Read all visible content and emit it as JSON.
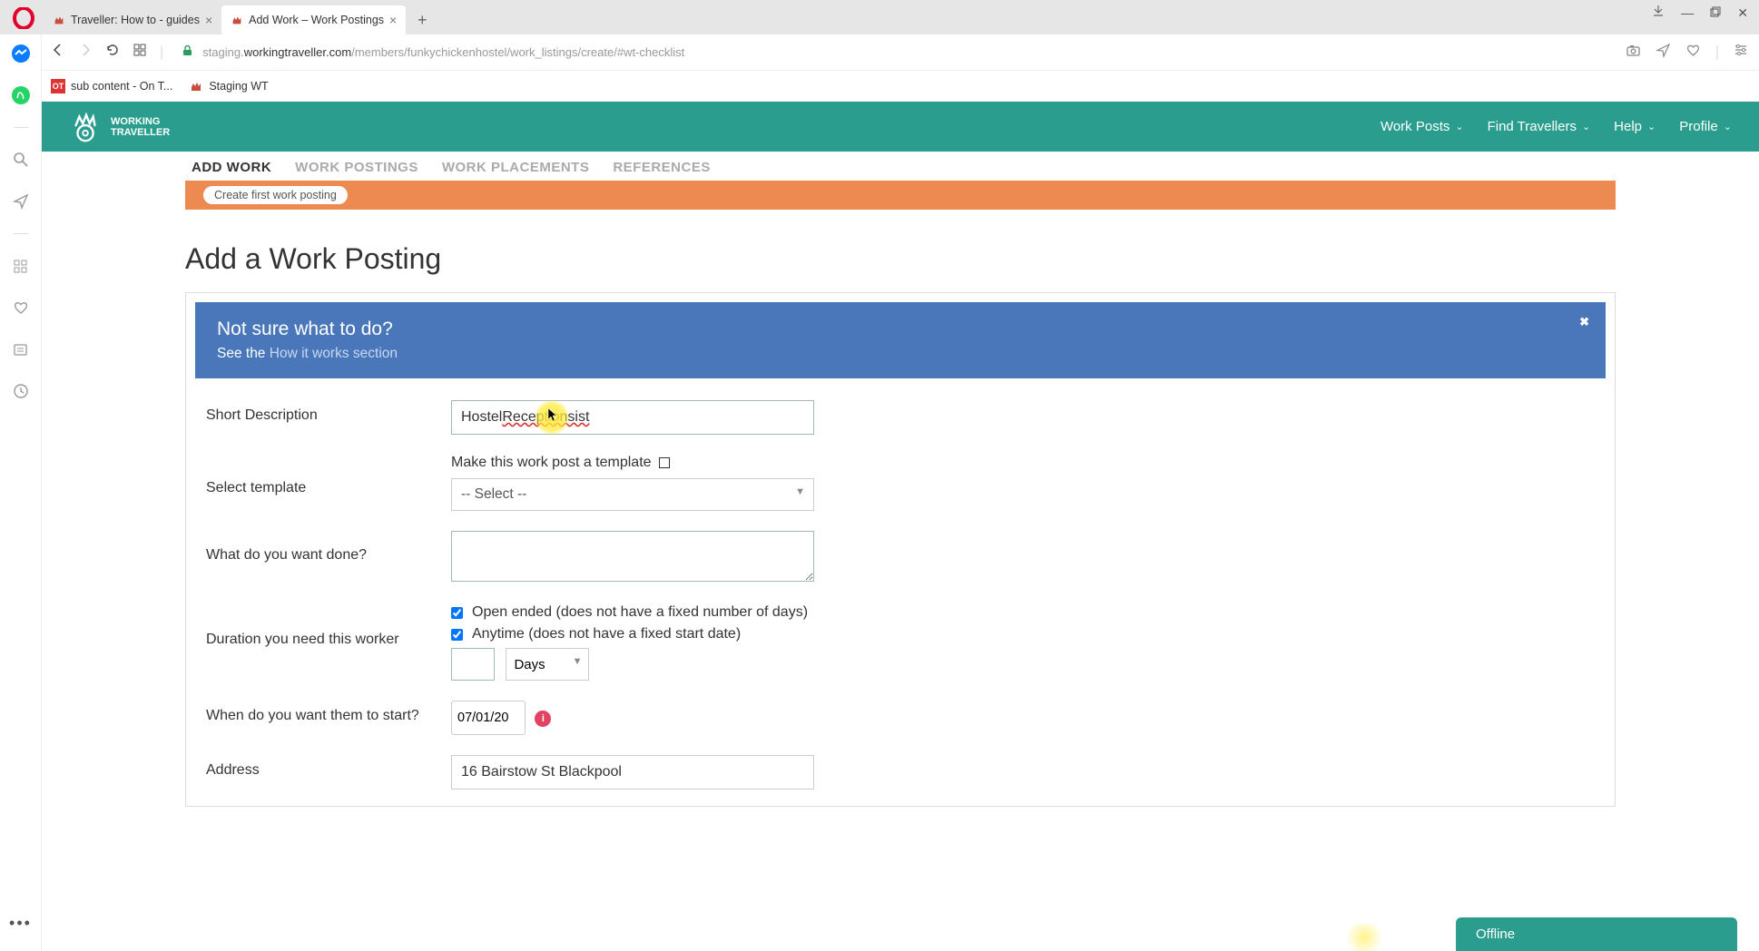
{
  "browser": {
    "tabs": [
      {
        "title": "Traveller: How to - guides",
        "active": false
      },
      {
        "title": "Add Work – Work Postings",
        "active": true
      }
    ],
    "url_prefix": "staging.",
    "url_domain": "workingtraveller.com",
    "url_path": "/members/funkychickenhostel/work_listings/create/#wt-checklist",
    "bookmarks": [
      {
        "label": "sub content - On T..."
      },
      {
        "label": "Staging WT"
      }
    ]
  },
  "nav": {
    "logo_line1": "WORKING",
    "logo_line2": "TRAVELLER",
    "items": [
      {
        "label": "Work Posts",
        "dropdown": true
      },
      {
        "label": "Find Travellers",
        "dropdown": true
      },
      {
        "label": "Help",
        "dropdown": true
      },
      {
        "label": "Profile",
        "dropdown": true
      }
    ]
  },
  "subnav": {
    "items": [
      {
        "label": "ADD WORK",
        "active": true
      },
      {
        "label": "WORK POSTINGS",
        "active": false
      },
      {
        "label": "WORK PLACEMENTS",
        "active": false
      },
      {
        "label": "REFERENCES",
        "active": false
      }
    ]
  },
  "orange_chip": "Create first work posting",
  "page_title": "Add a Work Posting",
  "help_banner": {
    "heading": "Not sure what to do?",
    "prefix": "See the ",
    "link": "How it works section"
  },
  "form": {
    "short_desc_label": "Short Description",
    "short_desc_value_plain": "Hostel ",
    "short_desc_value_spell": "Receptionsist",
    "template_label": "Make this work post a template",
    "select_template_label": "Select template",
    "select_template_value": "-- Select --",
    "what_done_label": "What do you want done?",
    "duration_label": "Duration you need this worker",
    "open_ended": "Open ended (does not have a fixed number of days)",
    "anytime": "Anytime (does not have a fixed start date)",
    "duration_unit": "Days",
    "start_label": "When do you want them to start?",
    "start_value": "07/01/20",
    "address_label": "Address",
    "address_value": "16 Bairstow St Blackpool"
  },
  "offline": "Offline"
}
